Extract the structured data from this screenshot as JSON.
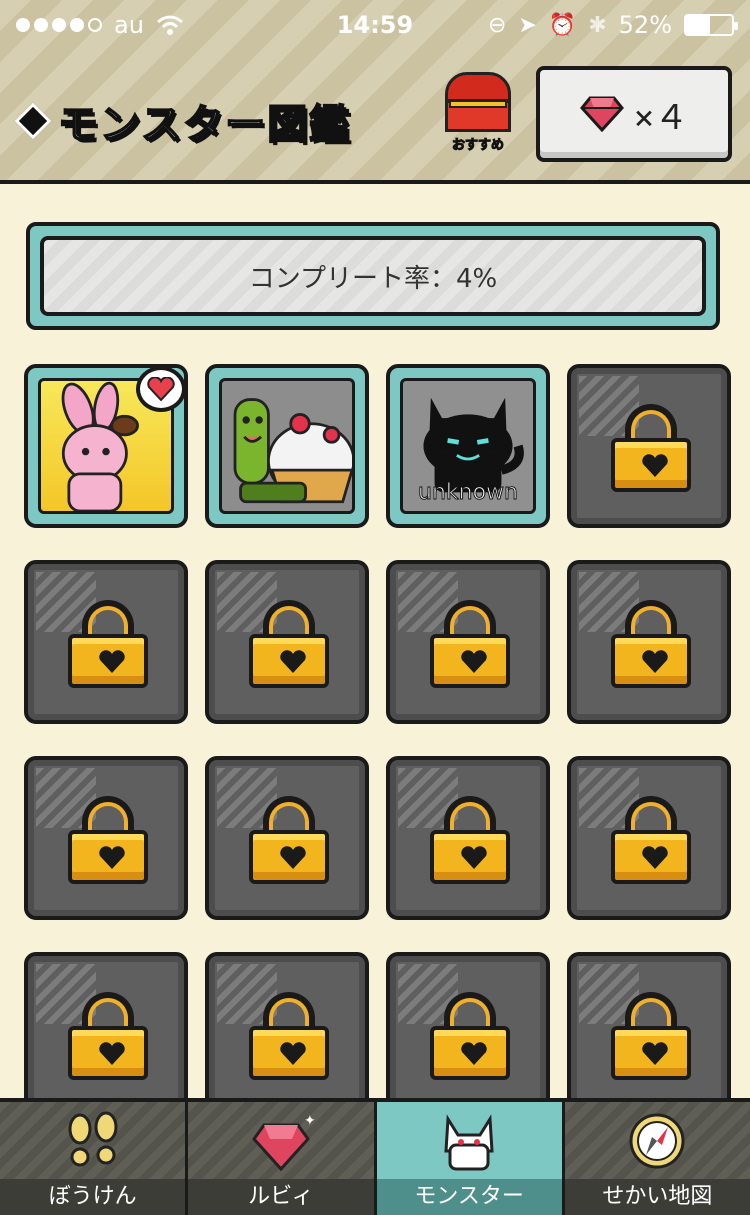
{
  "status": {
    "carrier": "au",
    "time": "14:59",
    "battery": "52%",
    "battery_level": 0.52
  },
  "header": {
    "title": "モンスター図鑑",
    "recommend_label": "おすすめ",
    "ruby_count": "×４"
  },
  "completion": {
    "text": "コンプリート率：4%"
  },
  "grid": {
    "monsters": [
      {
        "state": "rabbit",
        "favorite": true
      },
      {
        "state": "turtle"
      },
      {
        "state": "cat",
        "label": "unknown"
      }
    ],
    "locked_count": 13
  },
  "tabs": [
    {
      "label": "ぼうけん",
      "icon": "footprints-icon",
      "active": false
    },
    {
      "label": "ルビィ",
      "icon": "ruby-icon",
      "active": false
    },
    {
      "label": "モンスター",
      "icon": "cat-icon",
      "active": true
    },
    {
      "label": "せかい地図",
      "icon": "compass-icon",
      "active": false
    }
  ],
  "colors": {
    "accent": "#7ec8c4",
    "background": "#f8f3d8",
    "lock": "#f3b51e",
    "ruby": "#e0455f"
  }
}
